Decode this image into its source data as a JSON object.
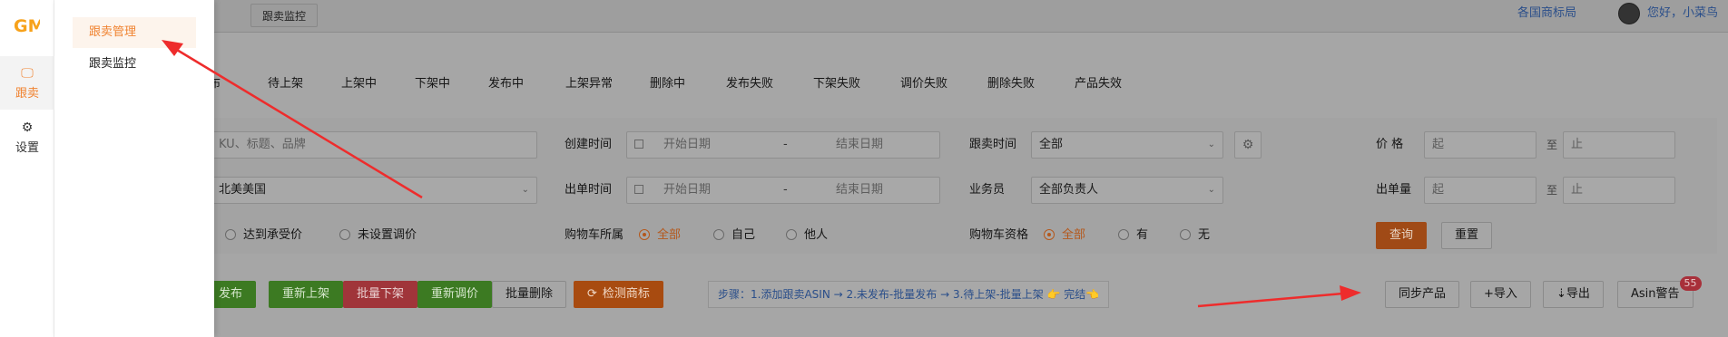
{
  "colors": {
    "accent": "#f08331",
    "annotation": "#ee2c2c"
  },
  "sidebar": {
    "logo_text": "GM",
    "items": [
      {
        "label": "跟卖",
        "icon": "monitor-icon",
        "active": true
      },
      {
        "label": "设置",
        "icon": "gear-icon",
        "active": false
      }
    ]
  },
  "submenu": {
    "items": [
      {
        "label": "跟卖管理",
        "active": true
      },
      {
        "label": "跟卖监控",
        "active": false
      }
    ]
  },
  "header": {
    "tab": "跟卖监控",
    "region_link": "各国商标局",
    "greeting": "您好，小菜鸟"
  },
  "status_tabs": [
    "布",
    "待上架",
    "上架中",
    "下架中",
    "发布中",
    "上架异常",
    "删除中",
    "发布失败",
    "下架失败",
    "调价失败",
    "删除失败",
    "产品失效"
  ],
  "filters": {
    "search_placeholder": "KU、标题、品牌",
    "create_time_label": "创建时间",
    "order_time_label": "出单时间",
    "start_placeholder": "开始日期",
    "end_placeholder": "结束日期",
    "range_sep": "-",
    "follow_time_label": "跟卖时间",
    "follow_time_value": "全部",
    "salesman_label": "业务员",
    "salesman_value": "全部负责人",
    "price_label": "价  格",
    "order_qty_label": "出单量",
    "from_placeholder": "起",
    "to_placeholder": "止",
    "range_word": "至",
    "market_value": "北美美国",
    "price_options": [
      "达到承受价",
      "未设置调价"
    ],
    "cart_owner_label": "购物车所属",
    "cart_owner_options": [
      "全部",
      "自己",
      "他人"
    ],
    "cart_owner_selected": 0,
    "cart_qual_label": "购物车资格",
    "cart_qual_options": [
      "全部",
      "有",
      "无"
    ],
    "cart_qual_selected": 0,
    "query_button": "查询",
    "reset_button": "重置"
  },
  "actions": {
    "publish": "发布",
    "relist": "重新上架",
    "batch_delist": "批量下架",
    "reprice": "重新调价",
    "batch_delete": "批量删除",
    "check_trademark": "检测商标",
    "steps_text": "步骤：1.添加跟卖ASIN → 2.未发布-批量发布 → 3.待上架-批量上架 👉 完结👈",
    "sync": "同步产品",
    "import": "+导入",
    "export": "⇣导出",
    "asin_warning": "Asin警告",
    "asin_warning_count": "55"
  }
}
